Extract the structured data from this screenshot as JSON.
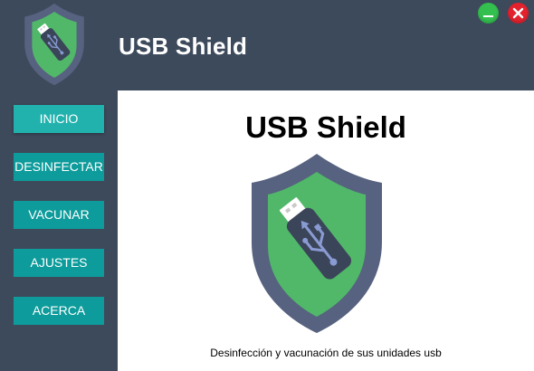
{
  "app": {
    "title": "USB Shield"
  },
  "window_controls": {
    "minimize_color": "#34c04f",
    "close_color": "#e4222e"
  },
  "sidebar": {
    "items": [
      {
        "label": "INICIO",
        "active": true
      },
      {
        "label": "DESINFECTAR",
        "active": false
      },
      {
        "label": "VACUNAR",
        "active": false
      },
      {
        "label": "AJUSTES",
        "active": false
      },
      {
        "label": "ACERCA",
        "active": false
      }
    ]
  },
  "main": {
    "title": "USB Shield",
    "subtitle": "Desinfección y vacunación de sus unidades usb"
  },
  "colors": {
    "header_bg": "#3d4a5c",
    "nav_button": "#0e9b9b",
    "nav_button_active": "#22b2ae",
    "shield_outer": "#56627f",
    "shield_inner": "#51b86a",
    "usb_body": "#3b4559"
  },
  "icons": [
    "usb-shield-logo-icon",
    "minimize-icon",
    "close-icon"
  ]
}
